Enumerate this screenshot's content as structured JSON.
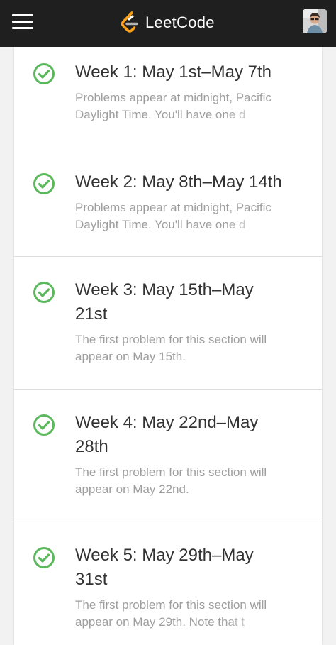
{
  "header": {
    "brand": "LeetCode",
    "logo_icon": "leetcode-logo-icon",
    "menu_icon": "hamburger-menu-icon",
    "avatar_icon": "user-avatar"
  },
  "colors": {
    "topbar": "#1f1f1f",
    "check_green": "#5cb85c",
    "logo_orange": "#ffa116",
    "title_text": "#333333",
    "desc_text": "#9e9e9e"
  },
  "weeks": [
    {
      "title": "Week 1: May 1st–May 7th",
      "desc_line1": "Problems appear at midnight, Pacific",
      "desc_line2": "Daylight Time. You'll have one d",
      "status_icon": "check-circle-icon"
    },
    {
      "title": "Week 2: May 8th–May 14th",
      "desc_line1": "Problems appear at midnight, Pacific",
      "desc_line2": "Daylight Time. You'll have one d",
      "status_icon": "check-circle-icon"
    },
    {
      "title": "Week 3: May 15th–May 21st",
      "desc_line1": "The first problem for this section will",
      "desc_line2": "appear on May 15th.",
      "status_icon": "check-circle-icon"
    },
    {
      "title": "Week 4: May 22nd–May 28th",
      "desc_line1": "The first problem for this section will",
      "desc_line2": "appear on May 22nd.",
      "status_icon": "check-circle-icon"
    },
    {
      "title": "Week 5: May 29th–May 31st",
      "desc_line1": "The first problem for this section will",
      "desc_line2": "appear on May 29th. Note that t",
      "status_icon": "check-circle-icon"
    }
  ]
}
